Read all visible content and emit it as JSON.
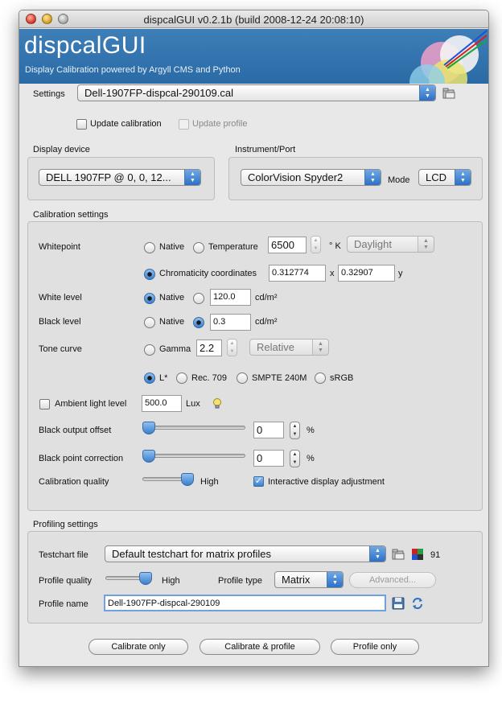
{
  "window": {
    "title": "dispcalGUI v0.2.1b (build 2008-12-24 20:08:10)"
  },
  "banner": {
    "title": "dispcalGUI",
    "subtitle": "Display Calibration powered by Argyll CMS and Python"
  },
  "settings": {
    "label": "Settings",
    "value": "Dell-1907FP-dispcal-290109.cal",
    "update_calibration": "Update calibration",
    "update_profile": "Update profile"
  },
  "display": {
    "label": "Display device",
    "value": "DELL 1907FP @ 0, 0, 12..."
  },
  "instrument": {
    "label": "Instrument/Port",
    "value": "ColorVision Spyder2",
    "mode_label": "Mode",
    "mode_value": "LCD"
  },
  "calibration": {
    "label": "Calibration settings",
    "whitepoint": {
      "label": "Whitepoint",
      "native": "Native",
      "temperature": "Temperature",
      "temperature_value": "6500",
      "unit": "° K",
      "illuminant": "Daylight",
      "chromaticity": "Chromaticity coordinates",
      "x_value": "0.312774",
      "x_label": "x",
      "y_value": "0.32907",
      "y_label": "y"
    },
    "white_level": {
      "label": "White level",
      "native": "Native",
      "value": "120.0",
      "unit": "cd/m²"
    },
    "black_level": {
      "label": "Black level",
      "native": "Native",
      "value": "0.3",
      "unit": "cd/m²"
    },
    "tone_curve": {
      "label": "Tone curve",
      "gamma": "Gamma",
      "gamma_value": "2.2",
      "mode": "Relative",
      "options": [
        "L*",
        "Rec. 709",
        "SMPTE 240M",
        "sRGB"
      ]
    },
    "ambient": {
      "label": "Ambient light level",
      "value": "500.0",
      "unit": "Lux"
    },
    "black_output_offset": {
      "label": "Black output offset",
      "value": "0",
      "unit": "%",
      "level": 0
    },
    "black_point_correction": {
      "label": "Black point correction",
      "value": "0",
      "unit": "%",
      "level": 0
    },
    "quality": {
      "label": "Calibration quality",
      "value": "High",
      "level": 1
    },
    "interactive": "Interactive display adjustment"
  },
  "profiling": {
    "label": "Profiling settings",
    "testchart_label": "Testchart file",
    "testchart_value": "Default testchart for matrix profiles",
    "testchart_count": "91",
    "quality_label": "Profile quality",
    "quality_value": "High",
    "quality_level": 1,
    "type_label": "Profile type",
    "type_value": "Matrix",
    "advanced": "Advanced...",
    "name_label": "Profile name",
    "name_value": "Dell-1907FP-dispcal-290109"
  },
  "actions": {
    "calibrate": "Calibrate only",
    "calibrate_profile": "Calibrate & profile",
    "profile": "Profile only"
  },
  "colors": {
    "banner": "#3470aa",
    "accent": "#3b7fd0"
  }
}
